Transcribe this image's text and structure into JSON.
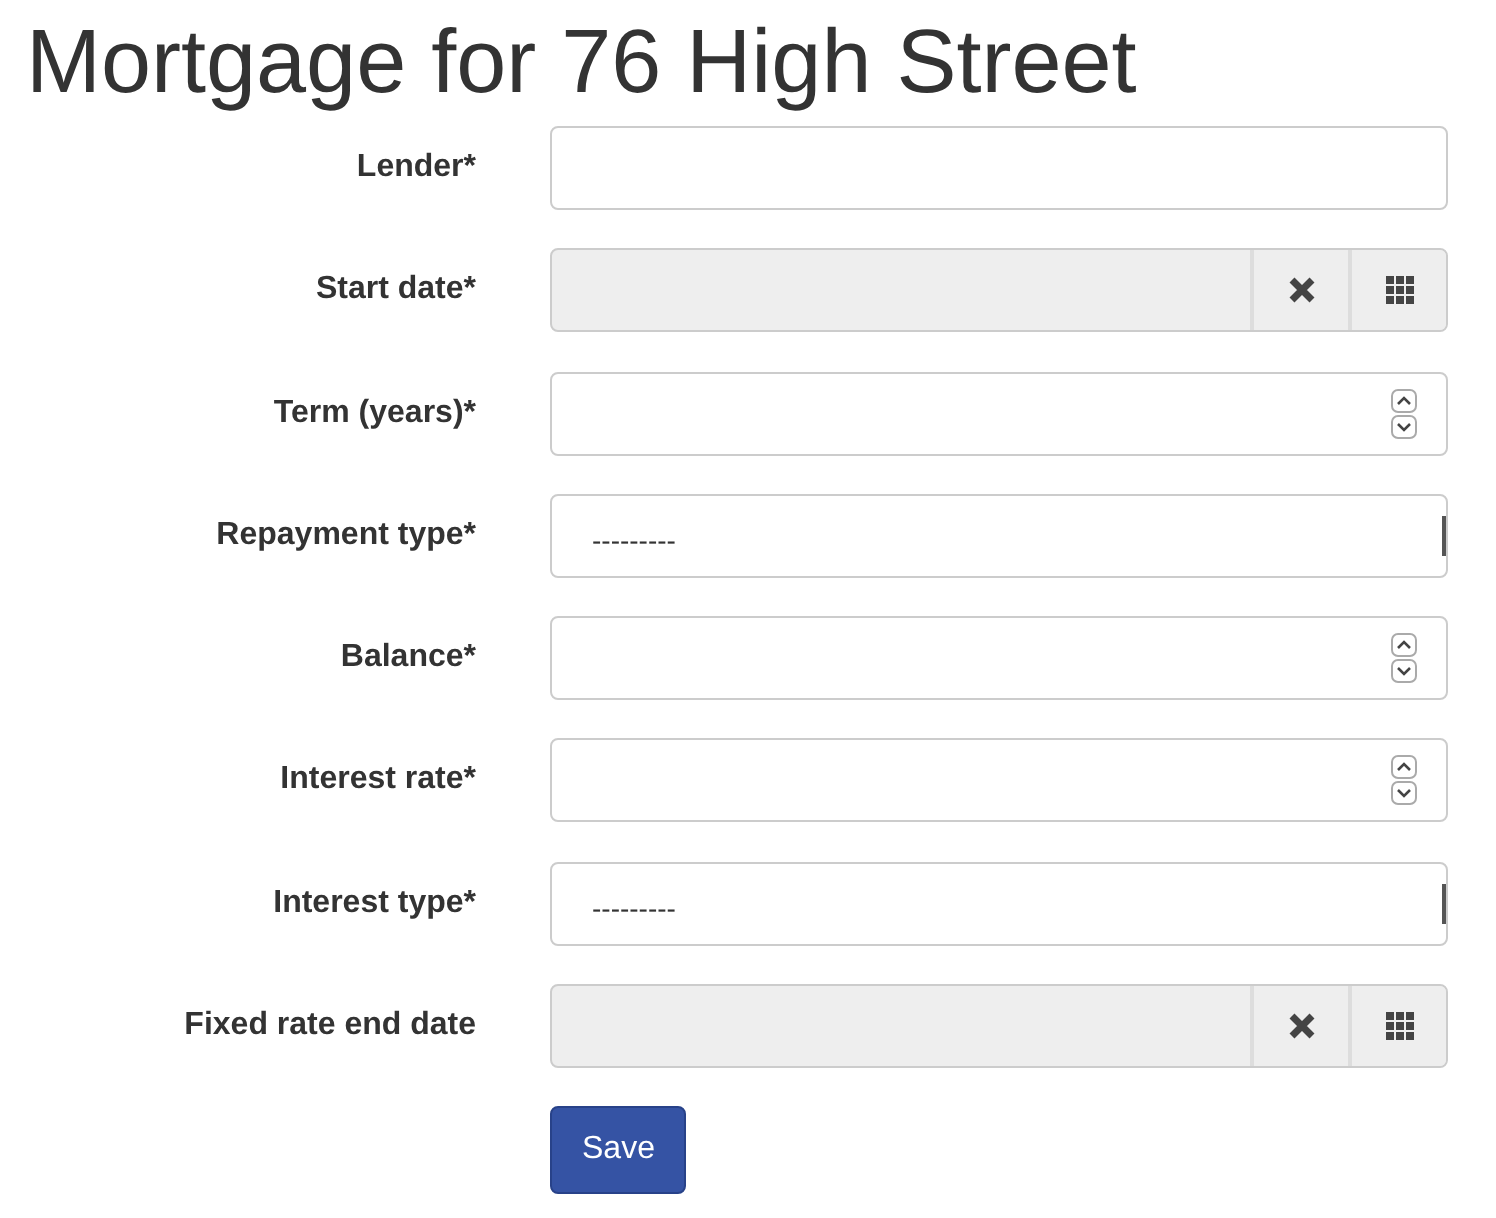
{
  "title": "Mortgage for 76 High Street",
  "fields": [
    {
      "label": "Lender*",
      "kind": "text"
    },
    {
      "label": "Start date*",
      "kind": "date",
      "disabled": true
    },
    {
      "label": "Term (years)*",
      "kind": "number"
    },
    {
      "label": "Repayment type*",
      "kind": "select",
      "value": "---------"
    },
    {
      "label": "Balance*",
      "kind": "number"
    },
    {
      "label": "Interest rate*",
      "kind": "number"
    },
    {
      "label": "Interest type*",
      "kind": "select",
      "value": "---------"
    },
    {
      "label": "Fixed rate end date",
      "kind": "date",
      "disabled": true
    }
  ],
  "button": "Save"
}
